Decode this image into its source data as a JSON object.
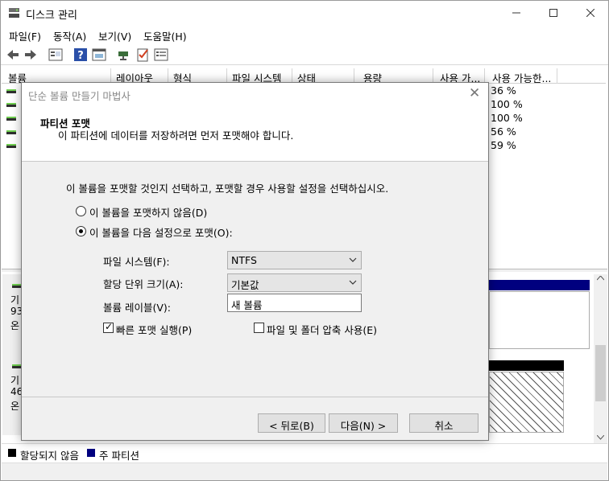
{
  "window": {
    "title": "디스크 관리",
    "icon": "disk-management-icon"
  },
  "menu": [
    "파일(F)",
    "동작(A)",
    "보기(V)",
    "도움말(H)"
  ],
  "toolbar_icons": [
    "back-icon",
    "forward-icon",
    "disk-list-icon",
    "help-icon",
    "properties-icon",
    "connect-icon",
    "check-icon",
    "settings-icon"
  ],
  "volume_list": {
    "columns": [
      "볼륨",
      "레이아웃",
      "형식",
      "파일 시스템",
      "상태",
      "용량",
      "사용 가...",
      "사용 가능한..."
    ],
    "rows": [
      {
        "pct": "36 %"
      },
      {
        "pct": "100 %"
      },
      {
        "pct": "100 %"
      },
      {
        "pct": "56 %"
      },
      {
        "pct": "59 %"
      }
    ]
  },
  "disks": [
    {
      "line1": "기",
      "line2": "93",
      "line3": "온"
    },
    {
      "line1": "기",
      "line2": "46",
      "line3": "온"
    }
  ],
  "legend": [
    {
      "label": "할당되지 않음",
      "color": "#000000"
    },
    {
      "label": "주 파티션",
      "color": "#00007f"
    }
  ],
  "wizard": {
    "title": "단순 볼륨 만들기 마법사",
    "header_title": "파티션 포맷",
    "header_desc": "이 파티션에 데이터를 저장하려면 먼저 포맷해야 합니다.",
    "instruction": "이 볼륨을 포맷할 것인지 선택하고, 포맷할 경우 사용할 설정을 선택하십시오.",
    "radio_noformat": "이 볼륨을 포맷하지 않음(D)",
    "radio_format": "이 볼륨을 다음 설정으로 포맷(O):",
    "fs_label": "파일 시스템(F):",
    "fs_value": "NTFS",
    "alloc_label": "할당 단위 크기(A):",
    "alloc_value": "기본값",
    "vol_label": "볼륨 레이블(V):",
    "vol_value": "새 볼륨",
    "quick_format": "빠른 포맷 실행(P)",
    "compress": "파일 및 폴더 압축 사용(E)",
    "btn_back": "< 뒤로(B)",
    "btn_next": "다음(N) >",
    "btn_cancel": "취소"
  }
}
